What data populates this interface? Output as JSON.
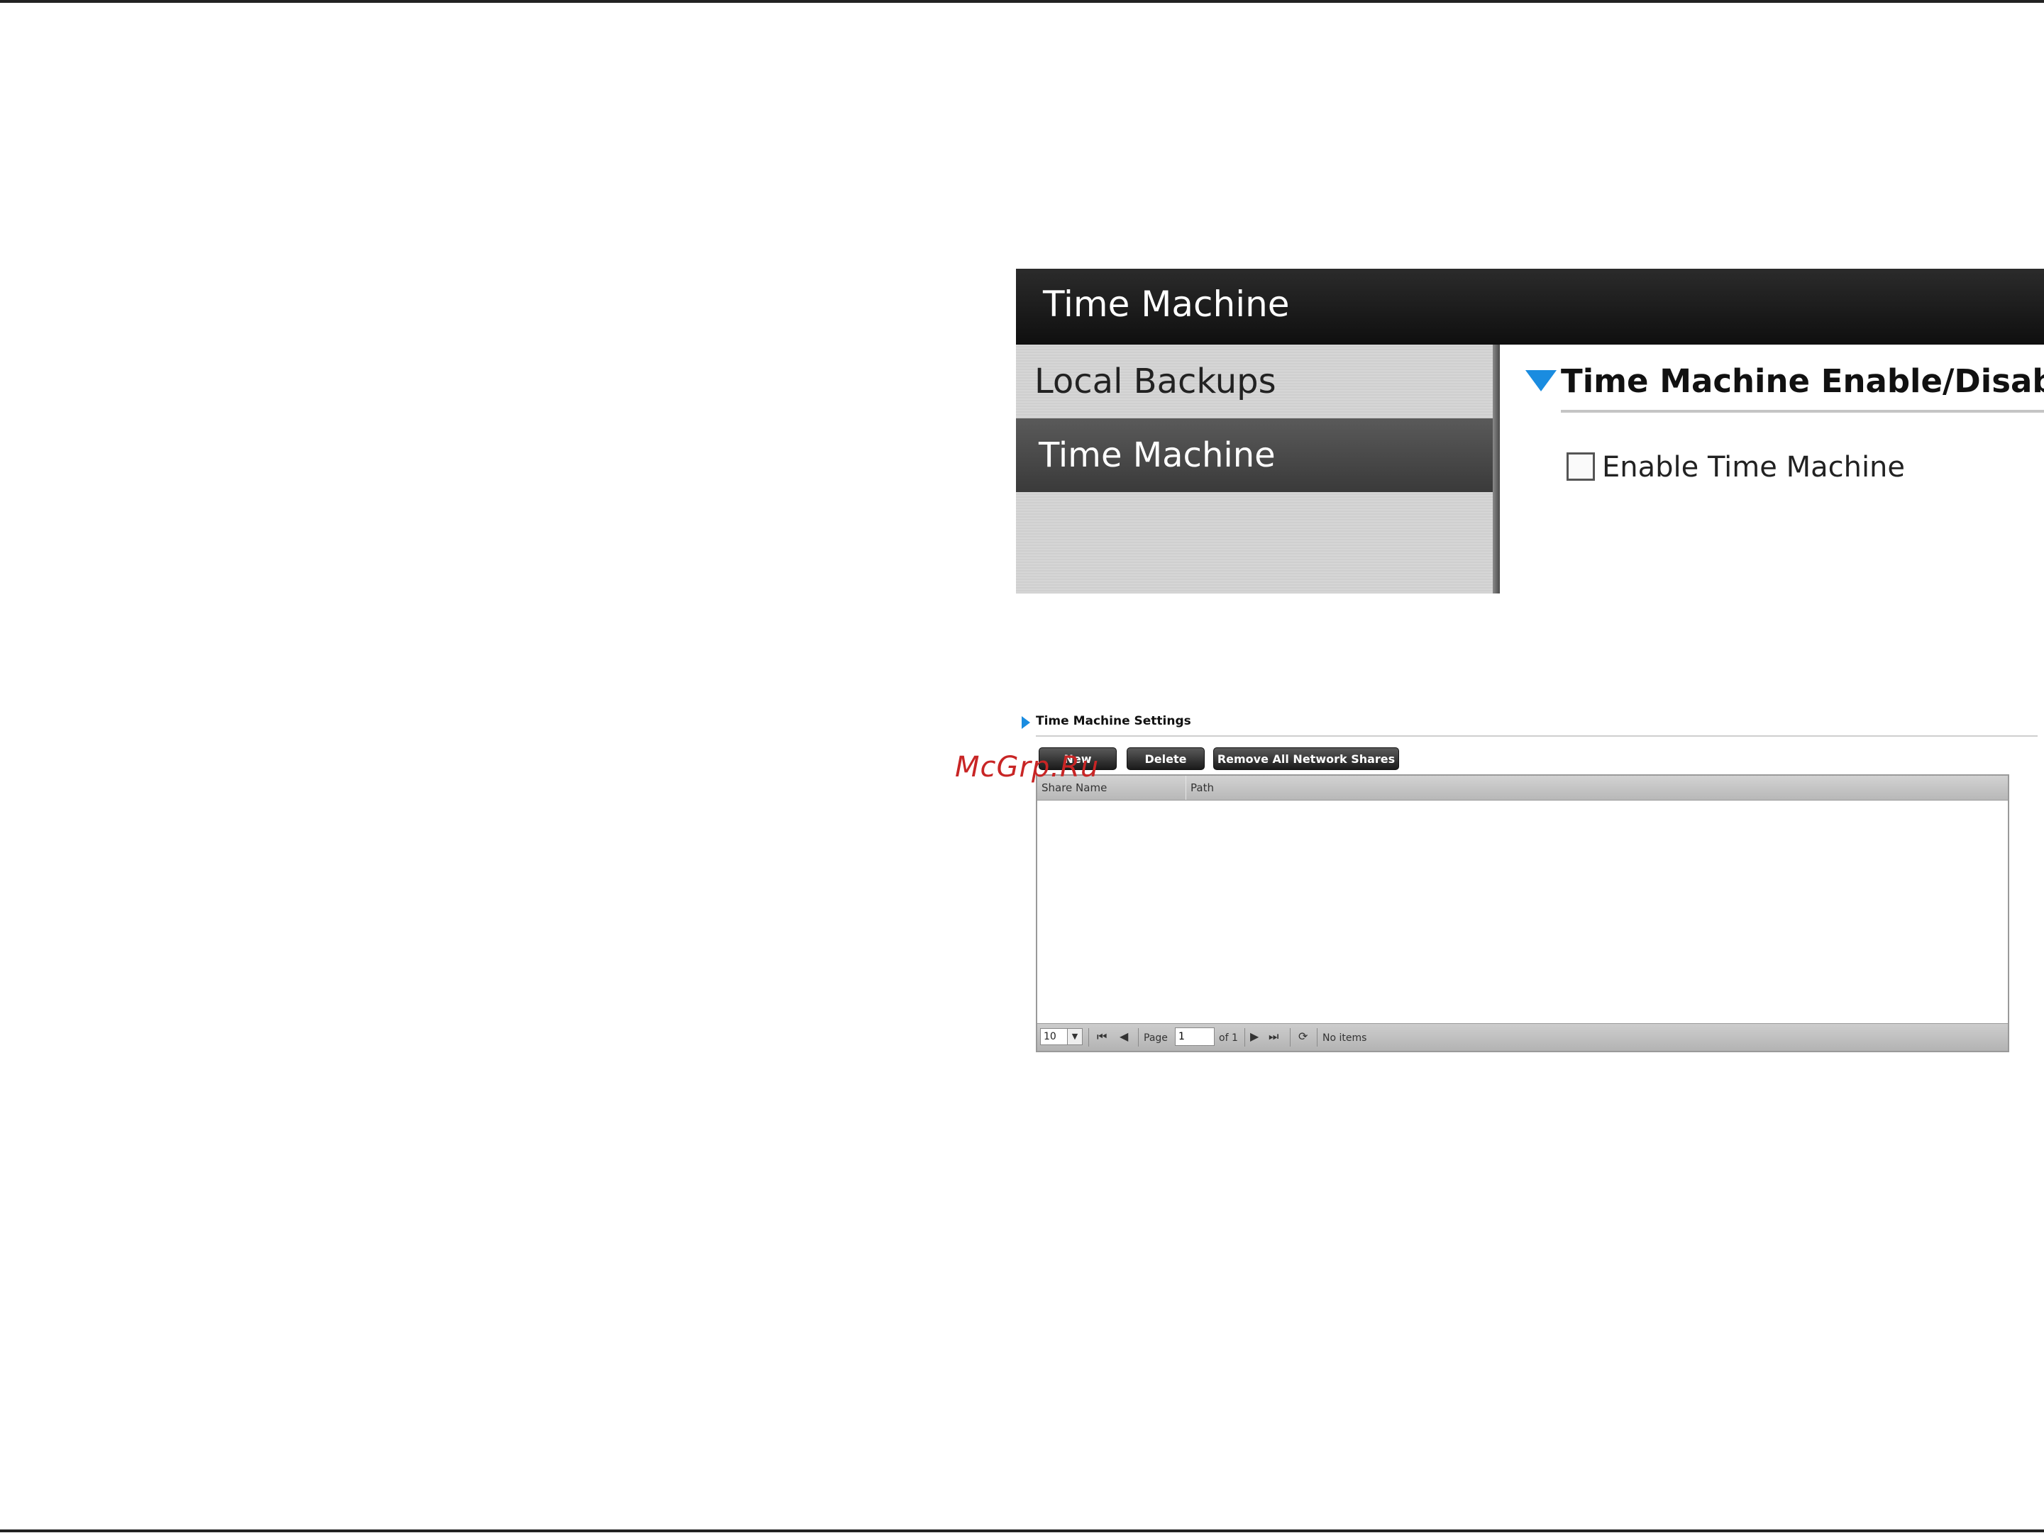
{
  "panel1": {
    "header_title": "Time Machine",
    "sidebar": {
      "items": [
        {
          "label": "Local Backups"
        },
        {
          "label": "Time Machine"
        }
      ]
    },
    "section_title": "Time Machine Enable/Disable",
    "checkbox_label": "Enable Time Machine"
  },
  "panel2": {
    "section_title": "Time Machine Settings",
    "buttons": {
      "new": "New",
      "delete": "Delete",
      "remove_all": "Remove All Network Shares"
    },
    "table": {
      "columns": [
        "Share Name",
        "Path"
      ]
    },
    "pager": {
      "page_size": "10",
      "page_label": "Page",
      "page_value": "1",
      "of_label": "of 1",
      "status": "No items"
    }
  },
  "watermark": "McGrp.Ru",
  "colors": {
    "accent_blue": "#1a8ce0",
    "header_dark": "#1a1a1a",
    "watermark_red": "#c82525"
  }
}
